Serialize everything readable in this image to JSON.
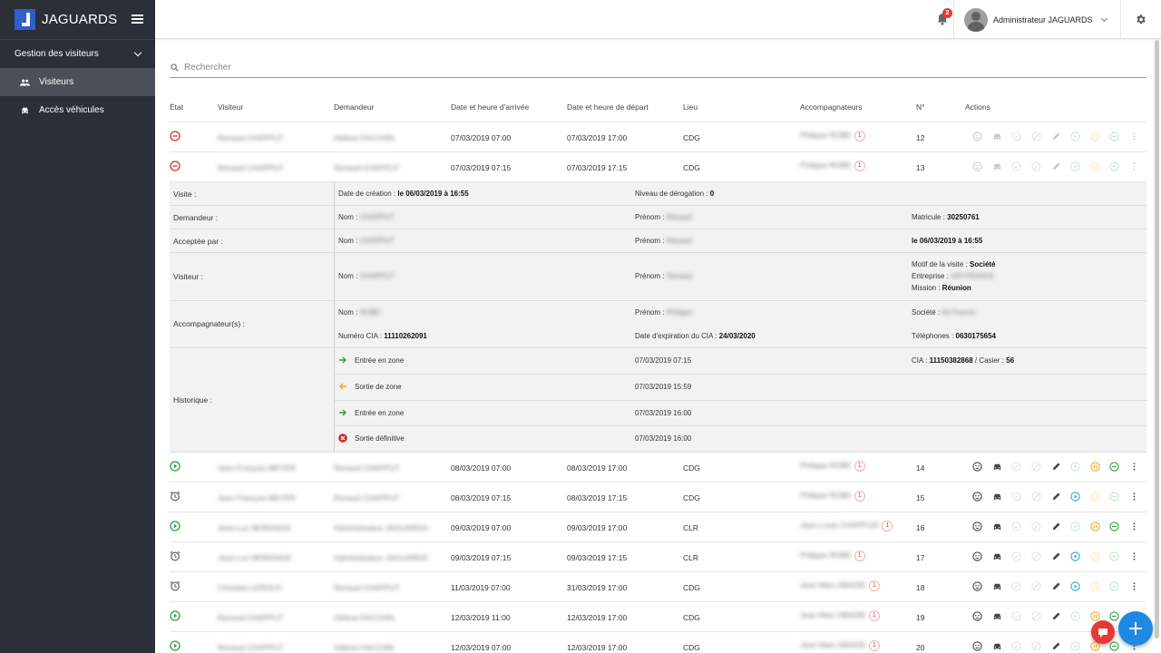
{
  "app": {
    "brand": "JAGUARDS"
  },
  "sidebar": {
    "group": "Gestion des visiteurs",
    "items": [
      {
        "label": "Visiteurs",
        "icon": "people-icon",
        "active": true
      },
      {
        "label": "Accès véhicules",
        "icon": "car-icon",
        "active": false
      }
    ]
  },
  "header": {
    "notifications": "2",
    "user": "Administrateur JAGUARDS"
  },
  "search": {
    "placeholder": "Rechercher"
  },
  "table": {
    "columns": [
      "État",
      "Visiteur",
      "Demandeur",
      "Date et heure d'arrivée",
      "Date et heure de départ",
      "Lieu",
      "Accompagnateurs",
      "N°",
      "Actions"
    ],
    "rows": [
      {
        "state": "stop",
        "visitor": "Renaud CHAPPUT",
        "requester": "Hélène FACCHIN",
        "arrival": "07/03/2019 07:00",
        "departure": "07/03/2019 17:00",
        "place": "CDG",
        "escort": "Philippe ROBE",
        "escort_count": "1",
        "number": "12",
        "enabled": false
      },
      {
        "state": "stop",
        "visitor": "Renaud CHAPPUT",
        "requester": "Renaud CHAPPUT",
        "arrival": "07/03/2019 07:15",
        "departure": "07/03/2019 17:15",
        "place": "CDG",
        "escort": "Philippe ROBE",
        "escort_count": "1",
        "number": "13",
        "enabled": false
      },
      {
        "state": "play",
        "visitor": "Jean François MEYER",
        "requester": "Renaud CHAPPUT",
        "arrival": "08/03/2019 07:00",
        "departure": "08/03/2019 17:00",
        "place": "CDG",
        "escort": "Philippe ROBE",
        "escort_count": "1",
        "number": "14",
        "enabled": true
      },
      {
        "state": "alarm",
        "visitor": "Jean François MEYER",
        "requester": "Renaud CHAPPUT",
        "arrival": "08/03/2019 07:15",
        "departure": "08/03/2019 17:15",
        "place": "CDG",
        "escort": "Philippe ROBE",
        "escort_count": "1",
        "number": "15",
        "enabled": true
      },
      {
        "state": "play",
        "visitor": "Jean-Luc MORANGE",
        "requester": "Administrateur JAGUARDS",
        "arrival": "09/03/2019 07:00",
        "departure": "09/03/2019 17:00",
        "place": "CLR",
        "escort": "Jean-Louis CHAPPUIS",
        "escort_count": "1",
        "number": "16",
        "enabled": true
      },
      {
        "state": "alarm",
        "visitor": "Jean-Luc MORANGE",
        "requester": "Administrateur JAGUARDS",
        "arrival": "09/03/2019 07:15",
        "departure": "09/03/2019 17:15",
        "place": "CLR",
        "escort": "Philippe ROBE",
        "escort_count": "1",
        "number": "17",
        "enabled": true
      },
      {
        "state": "alarm",
        "visitor": "Christian LEROUX",
        "requester": "Renaud CHAPPUT",
        "arrival": "11/03/2019 07:00",
        "departure": "31/03/2019 17:00",
        "place": "CDG",
        "escort": "Jean Marc ABADIE",
        "escort_count": "1",
        "number": "18",
        "enabled": true
      },
      {
        "state": "play",
        "visitor": "Renaud CHAPPUT",
        "requester": "Hélène FACCHIN",
        "arrival": "12/03/2019 11:00",
        "departure": "12/03/2019 17:00",
        "place": "CDG",
        "escort": "Jean Marc ABADIE",
        "escort_count": "1",
        "number": "19",
        "enabled": true
      },
      {
        "state": "play",
        "visitor": "Renaud CHAPPUT",
        "requester": "Hélène FACCHIN",
        "arrival": "12/03/2019 07:00",
        "departure": "12/03/2019 17:00",
        "place": "CDG",
        "escort": "Jean Marc ABADIE",
        "escort_count": "1",
        "number": "20",
        "enabled": true
      }
    ]
  },
  "detail": {
    "visite_label": "Visite :",
    "creation_label": "Date de création :",
    "creation_value": "le 06/03/2019 à 16:55",
    "derogation_label": "Niveau de dérogation :",
    "derogation_value": "0",
    "demandeur_label": "Demandeur :",
    "nom_label": "Nom :",
    "prenom_label": "Prénom :",
    "demandeur_nom": "CHAPPUT",
    "demandeur_prenom": "Renaud",
    "matricule_label": "Matricule :",
    "matricule_value": "30250761",
    "acceptee_label": "Acceptée par :",
    "acceptee_nom": "CHAPPUT",
    "acceptee_prenom": "Renaud",
    "acceptee_date": "le 06/03/2019 à 16:55",
    "visiteur_label": "Visiteur :",
    "visiteur_nom": "CHAPPUT",
    "visiteur_prenom": "Renaud",
    "motif_label": "Motif de la visite :",
    "motif_value": "Société",
    "entreprise_label": "Entreprise :",
    "entreprise_value": "AIR FRANCE",
    "mission_label": "Mission :",
    "mission_value": "Réunion",
    "accomp_label": "Accompagnateur(s) :",
    "accomp_nom": "ROBE",
    "accomp_prenom": "Philippe",
    "societe_label": "Société :",
    "societe_value": "Air France",
    "cia_num_label": "Numéro CIA :",
    "cia_num_value": "11110262091",
    "cia_exp_label": "Date d'expiration du CIA :",
    "cia_exp_value": "24/03/2020",
    "tel_label": "Téléphones :",
    "tel_value": "0630175654",
    "historique_label": "Historique :",
    "cia_label": "CIA :",
    "cia_value": "11150382868",
    "casier_label": "/ Casier :",
    "casier_value": "56",
    "history": [
      {
        "event": "Entrée en zone",
        "time": "07/03/2019 07:15",
        "icon": "arrow-right-icon"
      },
      {
        "event": "Sortie de zone",
        "time": "07/03/2019 15:59",
        "icon": "arrow-left-icon"
      },
      {
        "event": "Entrée en zone",
        "time": "07/03/2019 16:00",
        "icon": "arrow-right-icon"
      },
      {
        "event": "Sortie définitive",
        "time": "07/03/2019 16:00",
        "icon": "close-circle-icon"
      }
    ]
  },
  "colors": {
    "sidebar": "#2b2f38",
    "accent": "#1e88e5",
    "stop": "#d32f2f",
    "play": "#2e9e3e",
    "warn": "#f5a623"
  }
}
